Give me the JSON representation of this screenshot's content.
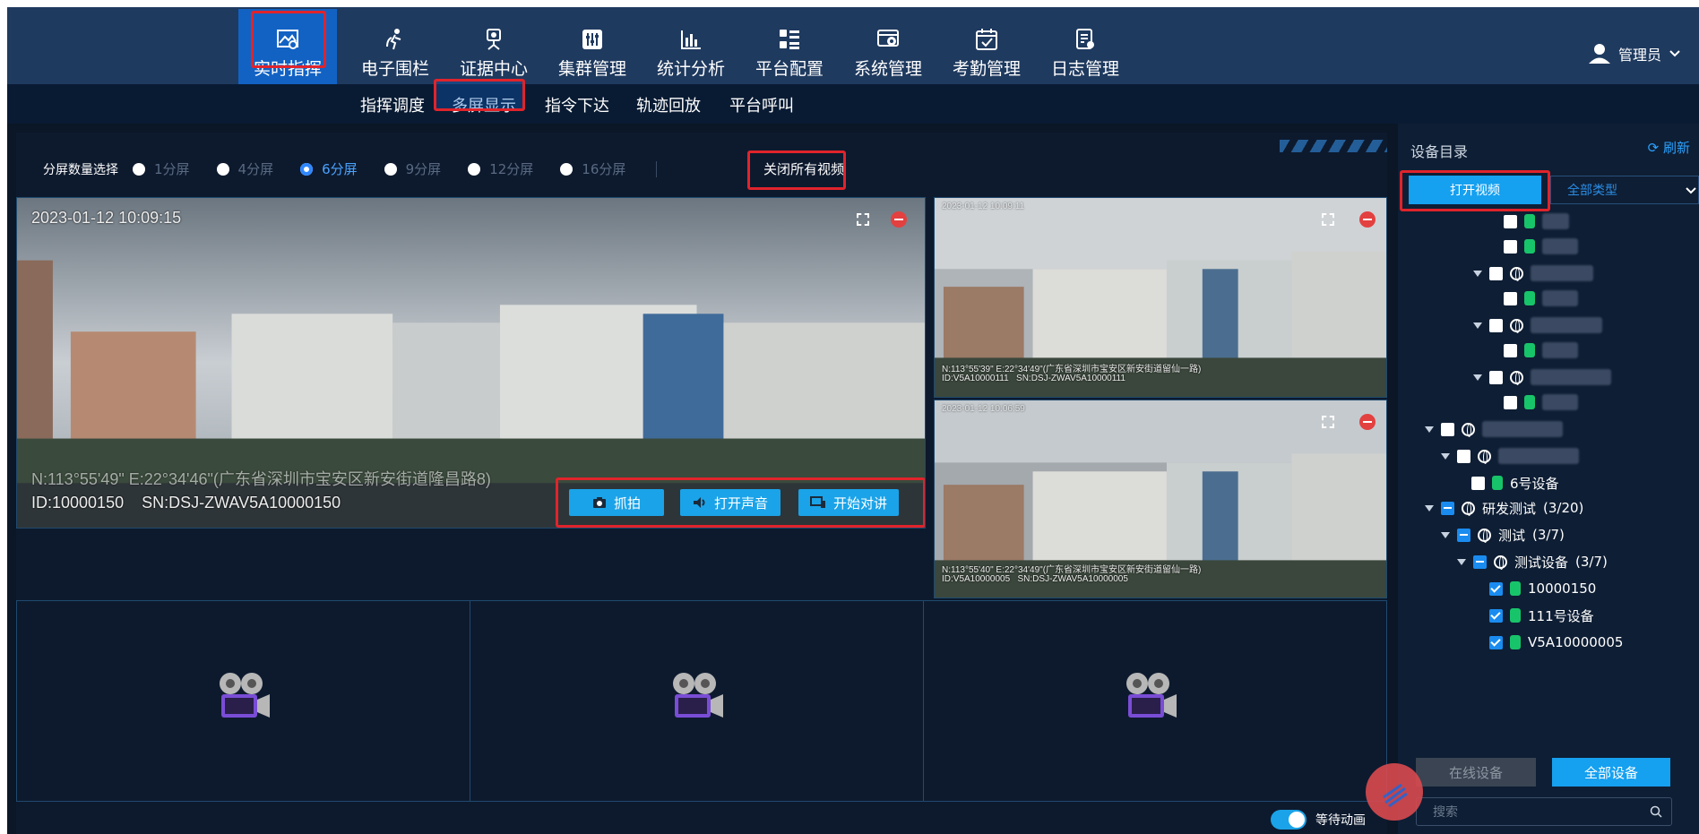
{
  "nav": {
    "items": [
      {
        "label": "实时指挥",
        "icon": "command-icon",
        "active": true
      },
      {
        "label": "电子围栏",
        "icon": "fence-icon"
      },
      {
        "label": "证据中心",
        "icon": "evidence-icon"
      },
      {
        "label": "集群管理",
        "icon": "cluster-icon"
      },
      {
        "label": "统计分析",
        "icon": "chart-icon"
      },
      {
        "label": "平台配置",
        "icon": "config-icon"
      },
      {
        "label": "系统管理",
        "icon": "system-icon"
      },
      {
        "label": "考勤管理",
        "icon": "calendar-icon"
      },
      {
        "label": "日志管理",
        "icon": "log-icon"
      }
    ],
    "user": "管理员",
    "user_icon": "user-icon"
  },
  "subnav": {
    "items": [
      "指挥调度",
      "多屏显示",
      "指令下达",
      "轨迹回放",
      "平台呼叫"
    ],
    "active": "多屏显示"
  },
  "split": {
    "label": "分屏数量选择",
    "options": [
      "1分屏",
      "4分屏",
      "6分屏",
      "9分屏",
      "12分屏",
      "16分屏"
    ],
    "selected": "6分屏",
    "close_all": "关闭所有视频"
  },
  "videos": [
    {
      "timestamp": "2023-01-12 10:09:15",
      "location": "N:113°55'49\" E:22°34'46\"(广东省深圳市宝安区新安街道隆昌路8)",
      "id_sn": "ID:10000150    SN:DSJ-ZWAV5A10000150",
      "buttons": [
        "抓拍",
        "打开声音",
        "开始对讲"
      ]
    },
    {
      "timestamp": "2023-01-12 10:09:11",
      "location": "N:113°55'39\" E:22°34'49\"(广东省深圳市宝安区新安街道留仙一路)",
      "id_sn": "ID:V5A10000111   SN:DSJ-ZWAV5A10000111"
    },
    {
      "timestamp": "2023-01-12 10:06:59",
      "location": "N:113°55'40\" E:22°34'49\"(广东省深圳市宝安区新安街道留仙一路)",
      "id_sn": "ID:V5A10000005   SN:DSJ-ZWAV5A10000005"
    }
  ],
  "toggle_label": "等待动画",
  "panel": {
    "title": "设备目录",
    "refresh": "刷新",
    "open_video": "打开视频",
    "type_select": "全部类型",
    "tree": {
      "device6": "6号设备",
      "group1": "研发测试",
      "group1_count": "(3/20)",
      "group2": "测试",
      "group2_count": "(3/7)",
      "group3": "测试设备",
      "group3_count": "(3/7)",
      "dev_a": "10000150",
      "dev_b": "111号设备",
      "dev_c": "V5A10000005"
    },
    "online_btn": "在线设备",
    "all_btn": "全部设备",
    "search_placeholder": "搜索"
  },
  "colors": {
    "accent": "#15a0f0",
    "highlight": "#e0242b",
    "nav_bg": "#1f3a5f",
    "device_online": "#18c46a"
  }
}
